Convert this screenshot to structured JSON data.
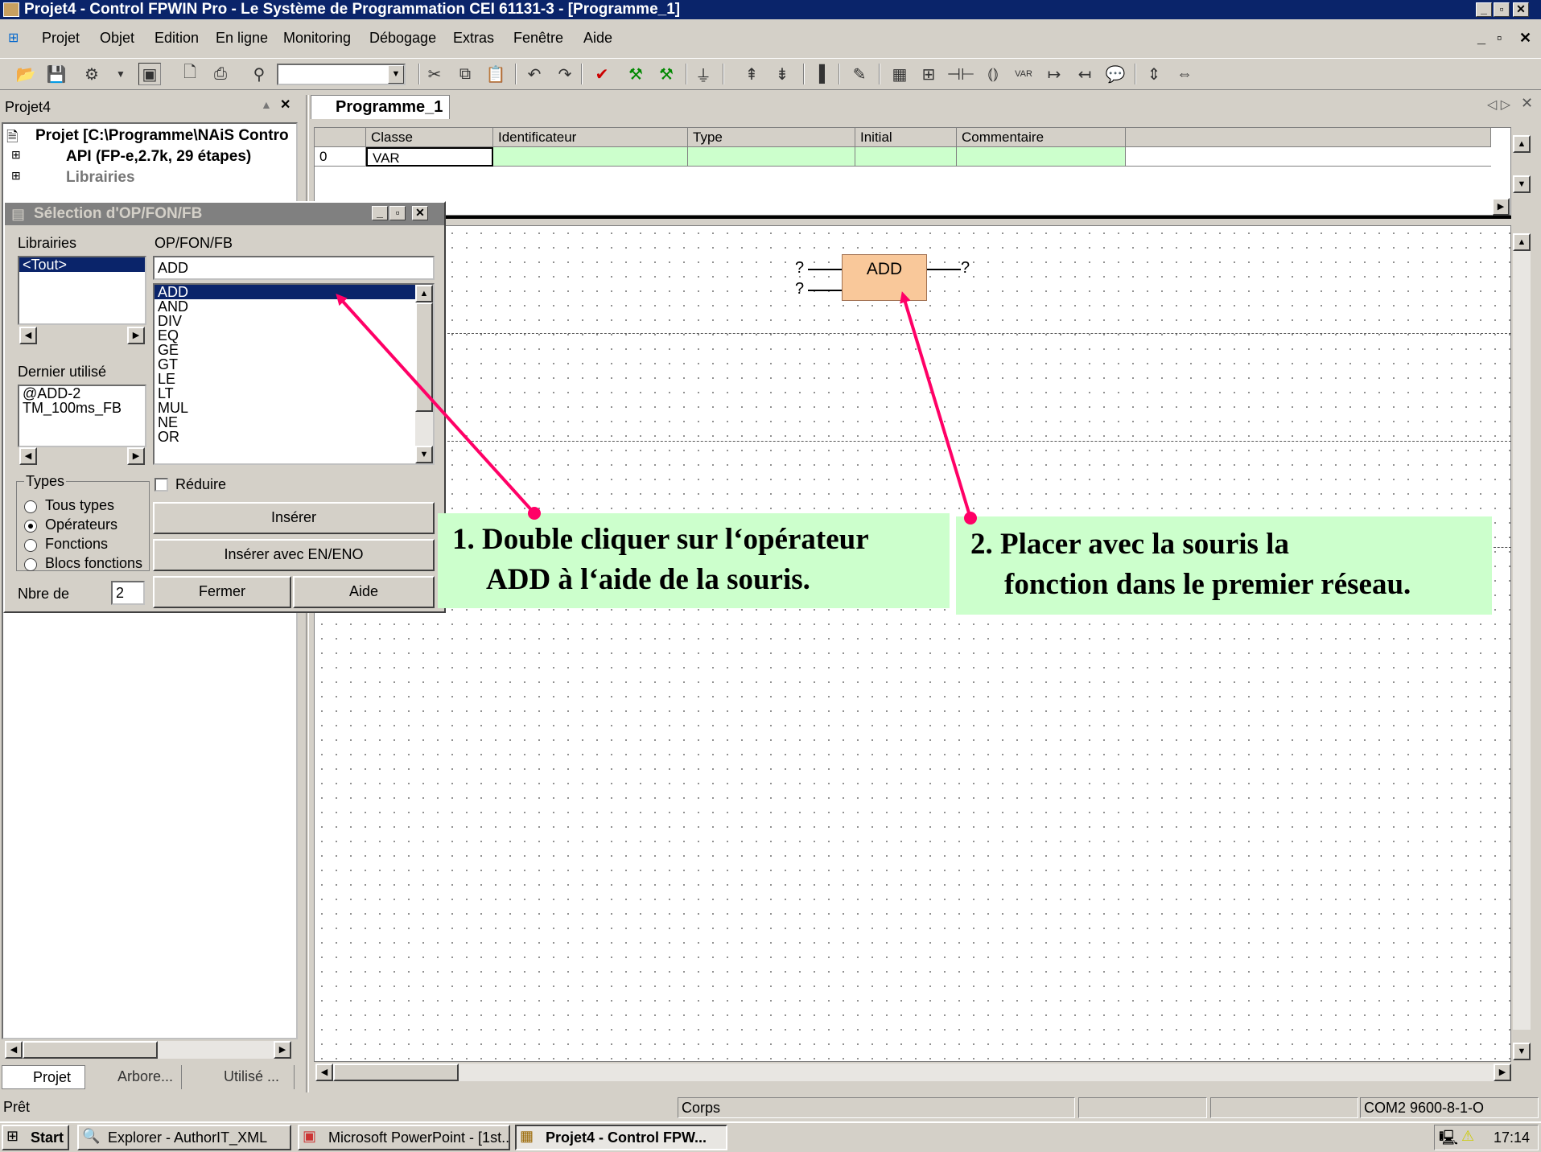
{
  "window": {
    "title": "Projet4 - Control FPWIN Pro - Le Système de Programmation CEI 61131-3 - [Programme_1]"
  },
  "menu": {
    "items": [
      "Projet",
      "Objet",
      "Edition",
      "En ligne",
      "Monitoring",
      "Débogage",
      "Extras",
      "Fenêtre",
      "Aide"
    ]
  },
  "left_panel": {
    "title": "Projet4",
    "tree": [
      "Projet [C:\\Programme\\NAiS Contro",
      "API (FP-e,2.7k, 29 étapes)",
      "Librairies"
    ],
    "tabs": [
      "Projet",
      "Arbore...",
      "Utilisé ..."
    ]
  },
  "editor": {
    "tab": "Programme_1",
    "header_row": {
      "columns": [
        "Classe",
        "Identificateur",
        "Type",
        "Initial",
        "Commentaire"
      ]
    },
    "rows": [
      {
        "index": "0",
        "classe": "VAR"
      }
    ],
    "block": {
      "name": "ADD",
      "input1": "?",
      "input2": "?",
      "output": "?"
    }
  },
  "dialog": {
    "title": "Sélection d'OP/FON/FB",
    "libraries_label": "Librairies",
    "libraries": [
      "<Tout>"
    ],
    "opfonfb_label": "OP/FON/FB",
    "search_value": "ADD",
    "operators": [
      "ADD",
      "AND",
      "DIV",
      "EQ",
      "GE",
      "GT",
      "LE",
      "LT",
      "MUL",
      "NE",
      "OR"
    ],
    "last_used_label": "Dernier utilisé",
    "last_used": [
      "@ADD-2",
      "TM_100ms_FB"
    ],
    "types_label": "Types",
    "types": [
      "Tous types",
      "Opérateurs",
      "Fonctions",
      "Blocs fonctions"
    ],
    "reduce_label": "Réduire",
    "insert_label": "Insérer",
    "insert_en_label": "Insérer avec EN/ENO",
    "count_label": "Nbre de",
    "count_value": "2",
    "close_label": "Fermer",
    "help_label": "Aide"
  },
  "callouts": {
    "one_line1": "1. Double cliquer sur l‘opérateur",
    "one_line2": "ADD à l‘aide de la souris.",
    "two_line1": "2. Placer avec la souris la",
    "two_line2": "fonction dans le premier réseau."
  },
  "status": {
    "ready": "Prêt",
    "section": "Corps",
    "port": "COM2 9600-8-1-O"
  },
  "taskbar": {
    "start": "Start",
    "tasks": [
      "Explorer - AuthorIT_XML",
      "Microsoft PowerPoint - [1st...",
      "Projet4 - Control FPW..."
    ],
    "clock": "17:14"
  },
  "colors": {
    "titlebar": "#0a246a",
    "callout": "#ccffcc",
    "arrow": "#ff0066",
    "block": "#f9c89a",
    "grid_row": "#ccffcc"
  }
}
